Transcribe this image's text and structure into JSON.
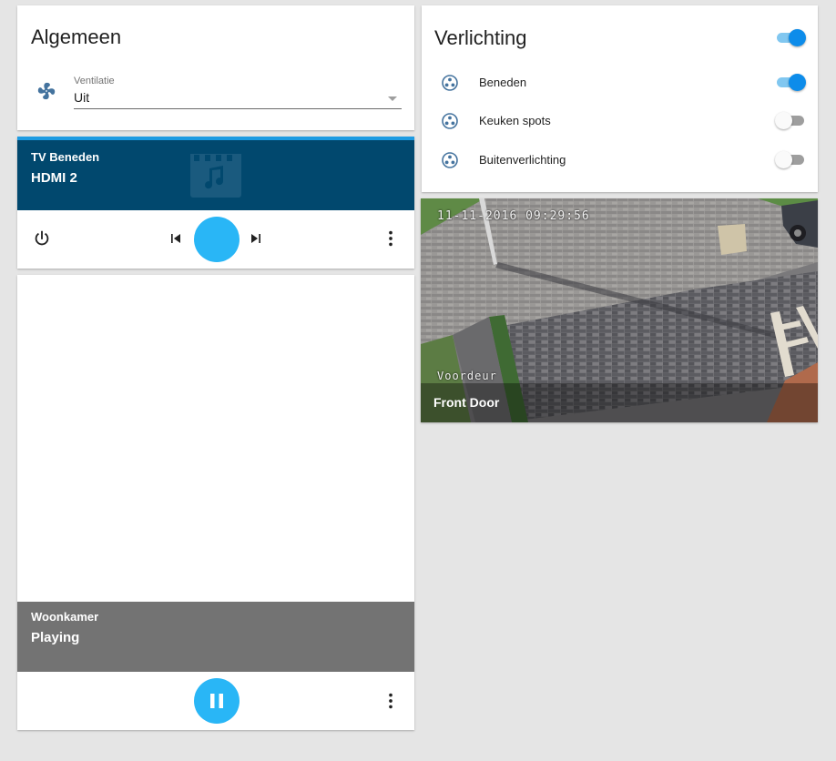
{
  "algemeen": {
    "title": "Algemeen",
    "ventilatie": {
      "label": "Ventilatie",
      "value": "Uit"
    }
  },
  "tv_beneden": {
    "name": "TV Beneden",
    "source": "HDMI 2"
  },
  "woonkamer": {
    "name": "Woonkamer",
    "state": "Playing"
  },
  "verlichting": {
    "title": "Verlichting",
    "master_on": true,
    "lights": [
      {
        "label": "Beneden",
        "on": true
      },
      {
        "label": "Keuken spots",
        "on": false
      },
      {
        "label": "Buitenverlichting",
        "on": false
      }
    ]
  },
  "camera": {
    "title": "Front Door",
    "timestamp": "11-11-2016 09:29:56",
    "osd_name": "Voordeur"
  },
  "colors": {
    "accent": "#29b6f6",
    "switch_on": "#0d8cea",
    "tv_header": "#01486e",
    "woonkamer_header": "#737373",
    "icon_blue": "#44739e"
  },
  "icons": {
    "ventilatie": "fan-icon",
    "lights": "light-bulb-group-icon",
    "tv_background": "music-video-icon",
    "power": "power-icon",
    "previous": "skip-previous-icon",
    "next": "skip-next-icon",
    "more": "more-vertical-icon",
    "pause": "pause-icon"
  }
}
